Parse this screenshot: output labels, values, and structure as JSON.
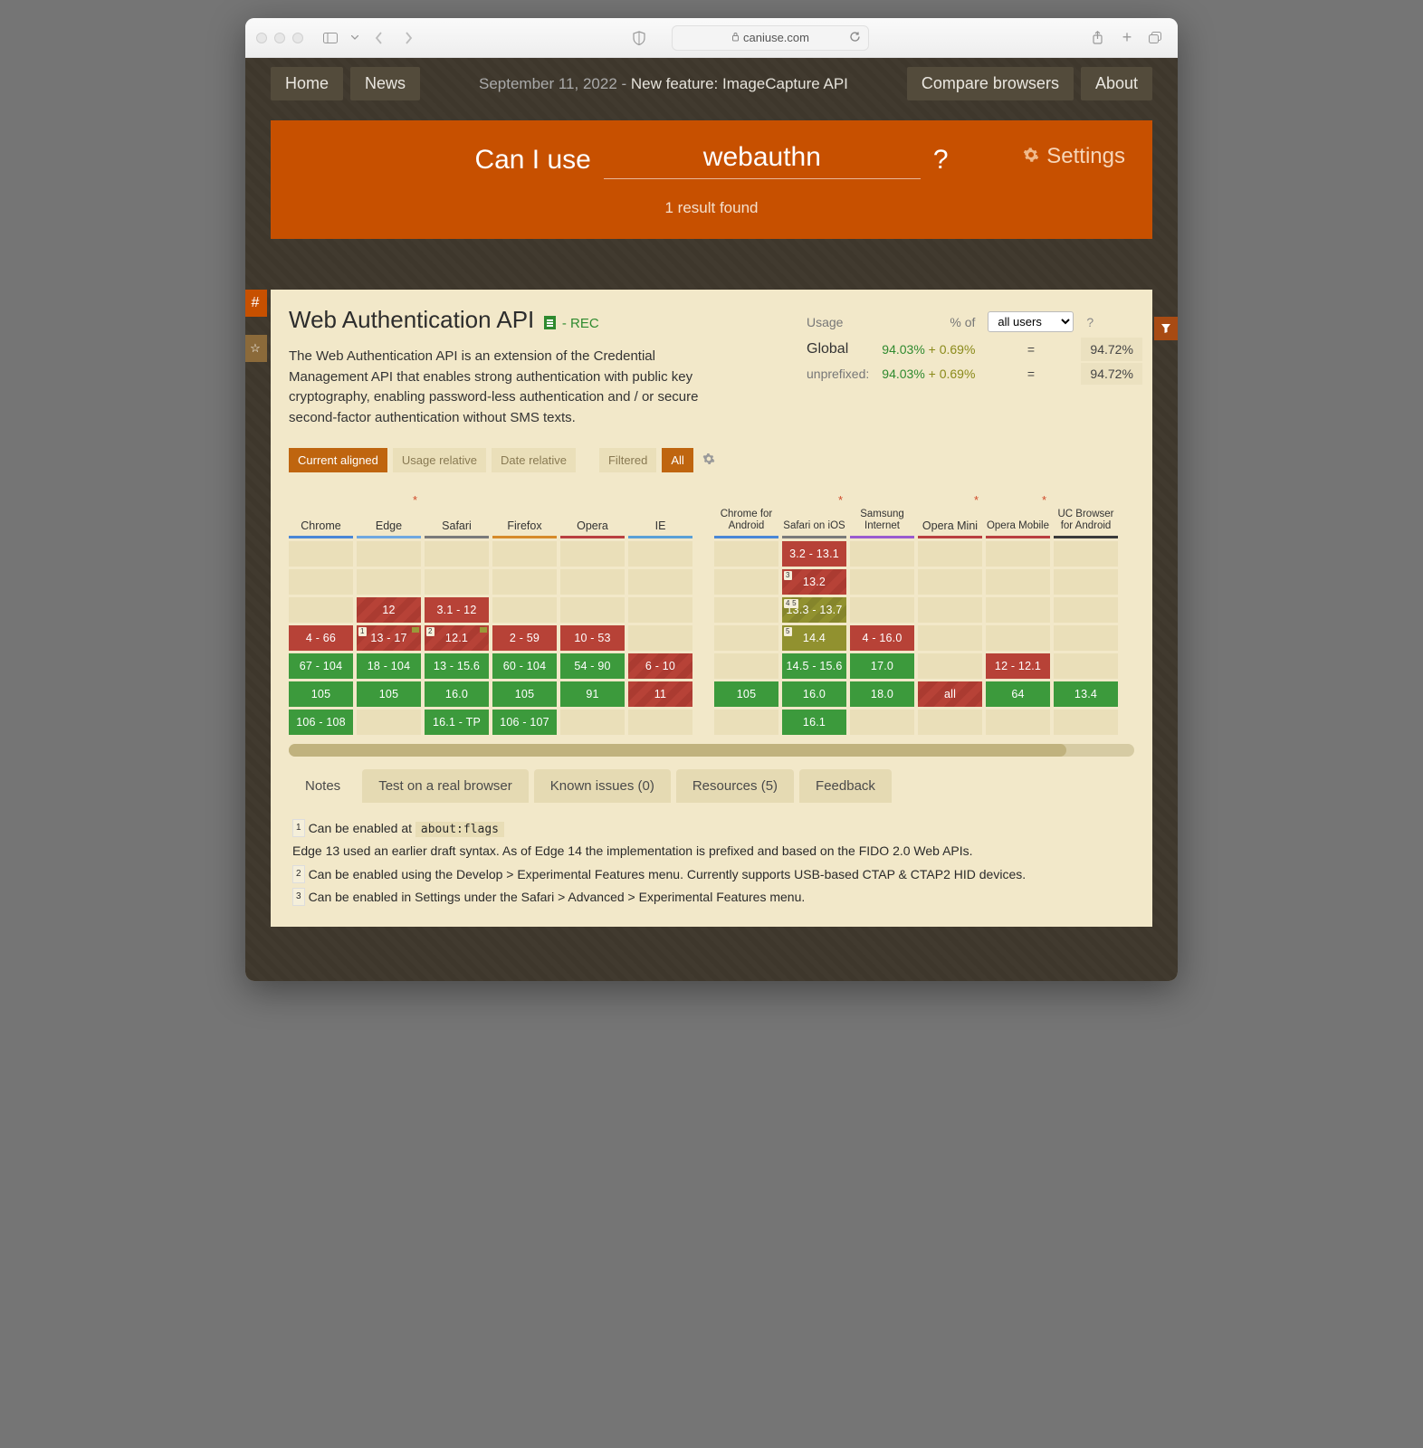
{
  "browser": {
    "url_host": "caniuse.com"
  },
  "nav": {
    "home": "Home",
    "news": "News",
    "date": "September 11, 2022 - ",
    "feature": "New feature: ImageCapture API",
    "compare": "Compare browsers",
    "about": "About"
  },
  "hero": {
    "can": "Can I use",
    "query": "webauthn",
    "qm": "?",
    "settings": "Settings",
    "result": "1 result found"
  },
  "feature": {
    "title": "Web Authentication API",
    "status": " - REC",
    "desc": "The Web Authentication API is an extension of the Credential Management API that enables strong authentication with public key cryptography, enabling password-less authentication and / or secure second-factor authentication without SMS texts."
  },
  "usage": {
    "usage_lbl": "Usage",
    "pct_of": "% of",
    "all_users": "all users",
    "global_lbl": "Global",
    "unprefixed_lbl": "unprefixed:",
    "global_main": "94.03%",
    "global_plus": "+ 0.69%",
    "eq": "=",
    "global_total": "94.72%",
    "unp_main": "94.03%",
    "unp_plus": "+ 0.69%",
    "unp_total": "94.72%"
  },
  "toggles": {
    "current": "Current aligned",
    "usage_rel": "Usage relative",
    "date_rel": "Date relative",
    "filtered": "Filtered",
    "all": "All"
  },
  "browsers": [
    {
      "id": "chrome",
      "name": "Chrome",
      "u": "u-chrome",
      "star": false,
      "cells": [
        {
          "t": "",
          "c": "empty"
        },
        {
          "t": "",
          "c": "empty"
        },
        {
          "t": "4 - 66",
          "c": "red"
        },
        {
          "t": "67 - 104",
          "c": "green"
        },
        {
          "t": "105",
          "c": "green"
        },
        {
          "t": "106 - 108",
          "c": "green"
        }
      ]
    },
    {
      "id": "edge",
      "name": "Edge",
      "u": "u-edge",
      "star": true,
      "cells": [
        {
          "t": "",
          "c": "empty"
        },
        {
          "t": "12",
          "c": "redstripe"
        },
        {
          "t": "13 - 17",
          "c": "redstripe",
          "note": "1",
          "flag": true
        },
        {
          "t": "18 - 104",
          "c": "green"
        },
        {
          "t": "105",
          "c": "green"
        },
        {
          "t": "",
          "c": "empty"
        }
      ]
    },
    {
      "id": "safari",
      "name": "Safari",
      "u": "u-safari",
      "star": false,
      "cells": [
        {
          "t": "",
          "c": "empty"
        },
        {
          "t": "3.1 - 12",
          "c": "red"
        },
        {
          "t": "12.1",
          "c": "redstripe",
          "note": "2",
          "flag": true
        },
        {
          "t": "13 - 15.6",
          "c": "green"
        },
        {
          "t": "16.0",
          "c": "green"
        },
        {
          "t": "16.1 - TP",
          "c": "green"
        }
      ]
    },
    {
      "id": "firefox",
      "name": "Firefox",
      "u": "u-ff",
      "star": false,
      "cells": [
        {
          "t": "",
          "c": "empty"
        },
        {
          "t": "",
          "c": "empty"
        },
        {
          "t": "2 - 59",
          "c": "red"
        },
        {
          "t": "60 - 104",
          "c": "green"
        },
        {
          "t": "105",
          "c": "green"
        },
        {
          "t": "106 - 107",
          "c": "green"
        }
      ]
    },
    {
      "id": "opera",
      "name": "Opera",
      "u": "u-opera",
      "star": false,
      "cells": [
        {
          "t": "",
          "c": "empty"
        },
        {
          "t": "",
          "c": "empty"
        },
        {
          "t": "10 - 53",
          "c": "red"
        },
        {
          "t": "54 - 90",
          "c": "green"
        },
        {
          "t": "91",
          "c": "green"
        },
        {
          "t": "",
          "c": "empty"
        }
      ]
    },
    {
      "id": "ie",
      "name": "IE",
      "u": "u-ie",
      "star": false,
      "cells": [
        {
          "t": "",
          "c": "empty"
        },
        {
          "t": "",
          "c": "empty"
        },
        {
          "t": "",
          "c": "empty"
        },
        {
          "t": "6 - 10",
          "c": "redstripe"
        },
        {
          "t": "11",
          "c": "redstripe"
        },
        {
          "t": "",
          "c": "empty"
        }
      ]
    }
  ],
  "browsers2": [
    {
      "id": "cfa",
      "name": "Chrome for Android",
      "u": "u-cfa",
      "star": false,
      "cells": [
        {
          "t": "",
          "c": "empty"
        },
        {
          "t": "",
          "c": "empty"
        },
        {
          "t": "",
          "c": "empty"
        },
        {
          "t": "",
          "c": "empty"
        },
        {
          "t": "105",
          "c": "green"
        },
        {
          "t": "",
          "c": "empty"
        }
      ]
    },
    {
      "id": "sios",
      "name": "Safari on iOS",
      "u": "u-sios",
      "star": true,
      "cells": [
        {
          "t": "3.2 - 13.1",
          "c": "red"
        },
        {
          "t": "13.2",
          "c": "redstripe",
          "note": "3"
        },
        {
          "t": "13.3 - 13.7",
          "c": "olivestripe",
          "note": "4 5"
        },
        {
          "t": "14.4",
          "c": "olive",
          "note": "5"
        },
        {
          "t": "14.5 - 15.6",
          "c": "green"
        },
        {
          "t": "16.0",
          "c": "green"
        },
        {
          "t": "16.1",
          "c": "green"
        }
      ],
      "pre": []
    },
    {
      "id": "sam",
      "name": "Samsung Internet",
      "u": "u-sam",
      "star": false,
      "cells": [
        {
          "t": "",
          "c": "empty"
        },
        {
          "t": "",
          "c": "empty"
        },
        {
          "t": "4 - 16.0",
          "c": "red"
        },
        {
          "t": "17.0",
          "c": "green"
        },
        {
          "t": "18.0",
          "c": "green"
        },
        {
          "t": "",
          "c": "empty"
        }
      ]
    },
    {
      "id": "omini",
      "name": "Opera Mini",
      "u": "u-omini",
      "star": true,
      "cells": [
        {
          "t": "",
          "c": "empty"
        },
        {
          "t": "",
          "c": "empty"
        },
        {
          "t": "",
          "c": "empty"
        },
        {
          "t": "",
          "c": "empty"
        },
        {
          "t": "all",
          "c": "redstripe"
        },
        {
          "t": "",
          "c": "empty"
        }
      ]
    },
    {
      "id": "omob",
      "name": "Opera Mobile",
      "u": "u-omob",
      "star": true,
      "cells": [
        {
          "t": "",
          "c": "empty"
        },
        {
          "t": "",
          "c": "empty"
        },
        {
          "t": "",
          "c": "empty"
        },
        {
          "t": "12 - 12.1",
          "c": "red"
        },
        {
          "t": "64",
          "c": "green"
        },
        {
          "t": "",
          "c": "empty"
        }
      ]
    },
    {
      "id": "uc",
      "name": "UC Browser for Android",
      "u": "u-uc",
      "star": false,
      "cells": [
        {
          "t": "",
          "c": "empty"
        },
        {
          "t": "",
          "c": "empty"
        },
        {
          "t": "",
          "c": "empty"
        },
        {
          "t": "",
          "c": "empty"
        },
        {
          "t": "13.4",
          "c": "green"
        },
        {
          "t": "",
          "c": "empty"
        }
      ]
    }
  ],
  "tabs": {
    "notes": "Notes",
    "test": "Test on a real browser",
    "known": "Known issues (0)",
    "resources": "Resources (5)",
    "feedback": "Feedback"
  },
  "notes": {
    "n1_pre": "Can be enabled at ",
    "n1_code": "about:flags",
    "edge_line": "Edge 13 used an earlier draft syntax. As of Edge 14 the implementation is prefixed and based on the FIDO 2.0 Web APIs.",
    "n2": "Can be enabled using the Develop > Experimental Features menu. Currently supports USB-based CTAP & CTAP2 HID devices.",
    "n3": "Can be enabled in Settings under the Safari > Advanced > Experimental Features menu."
  }
}
